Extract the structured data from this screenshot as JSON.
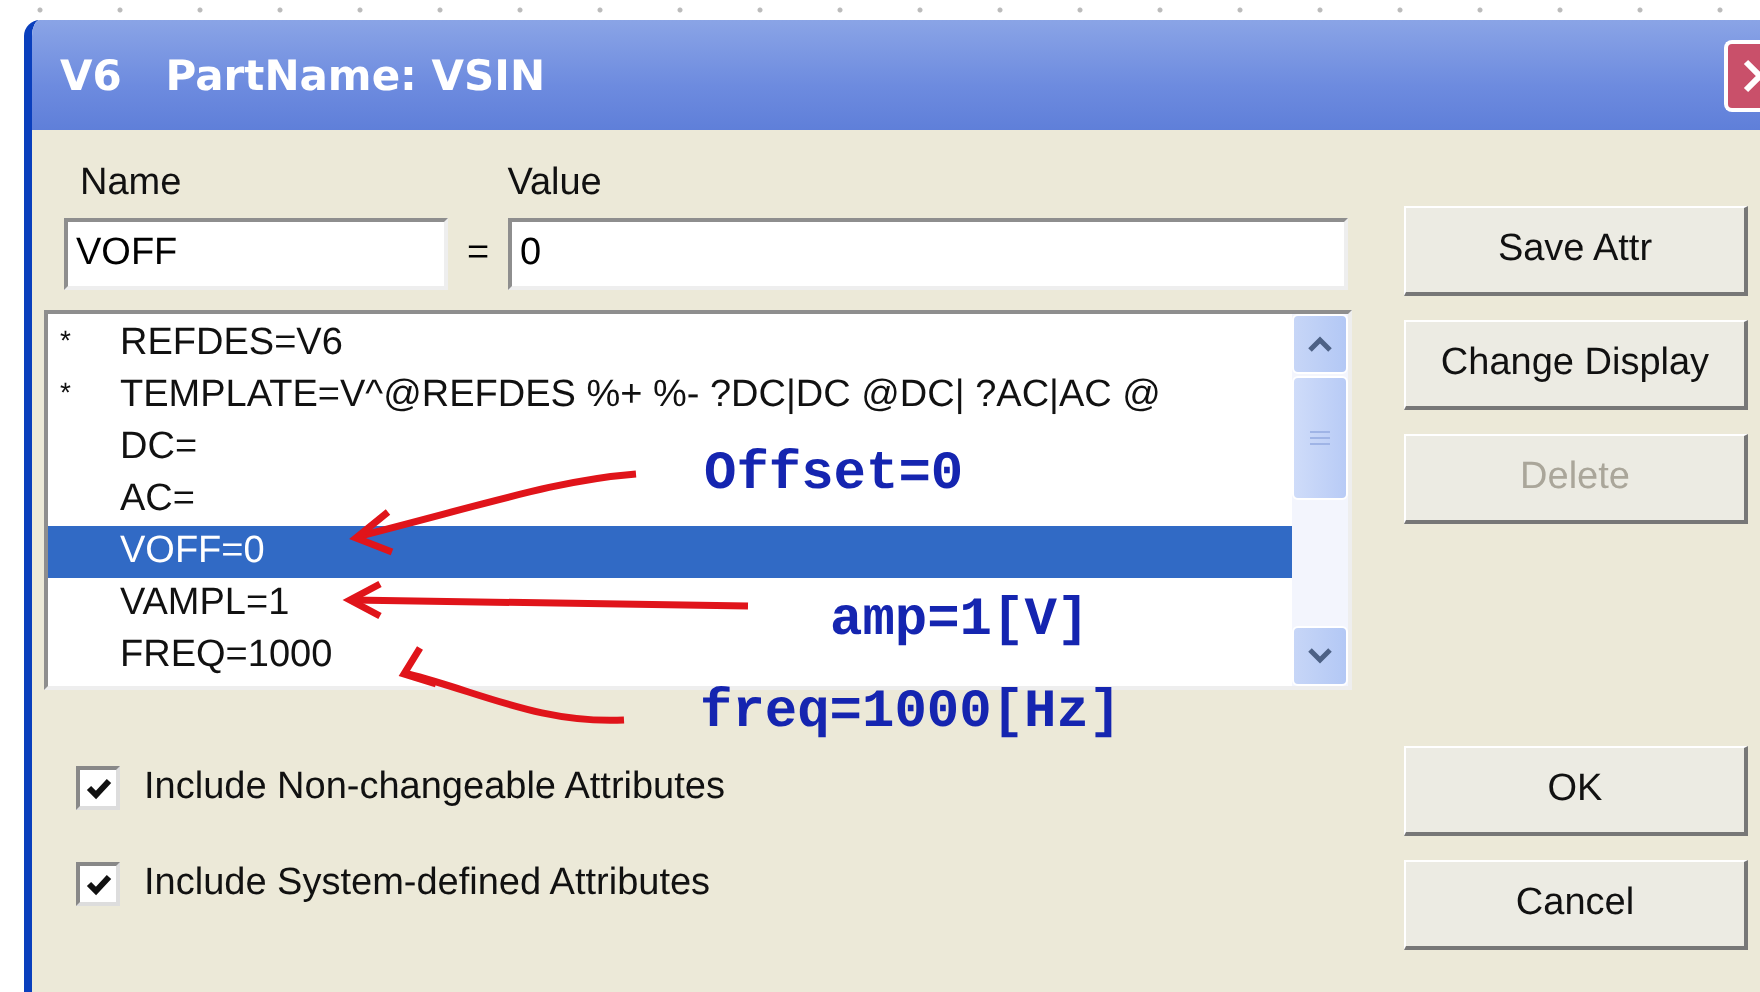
{
  "window": {
    "title": "V6   PartName: VSIN"
  },
  "name_label": "Name",
  "value_label": "Value",
  "name_field": {
    "value": "VOFF"
  },
  "equals": "=",
  "value_field": {
    "value": "0"
  },
  "attributes": [
    {
      "marker": "*",
      "text": "REFDES=V6",
      "selected": false
    },
    {
      "marker": "*",
      "text": "TEMPLATE=V^@REFDES %+ %- ?DC|DC @DC| ?AC|AC @",
      "selected": false
    },
    {
      "text": "DC=",
      "selected": false
    },
    {
      "text": "AC=",
      "selected": false
    },
    {
      "text": "VOFF=0",
      "selected": true
    },
    {
      "text": "VAMPL=1",
      "selected": false
    },
    {
      "text": "FREQ=1000",
      "selected": false
    }
  ],
  "buttons": [
    {
      "label": "Save Attr",
      "disabled": false
    },
    {
      "label": "Change Display",
      "disabled": false
    },
    {
      "label": "Delete",
      "disabled": true
    }
  ],
  "checkboxes": [
    {
      "label": "Include Non-changeable Attributes",
      "checked": true
    },
    {
      "label": "Include System-defined Attributes",
      "checked": true
    }
  ],
  "dialog_buttons": [
    {
      "label": "OK"
    },
    {
      "label": "Cancel"
    }
  ],
  "annotations": [
    {
      "text": "Offset=0"
    },
    {
      "text": "amp=1[V]"
    },
    {
      "text": "freq=1000[Hz]"
    }
  ]
}
